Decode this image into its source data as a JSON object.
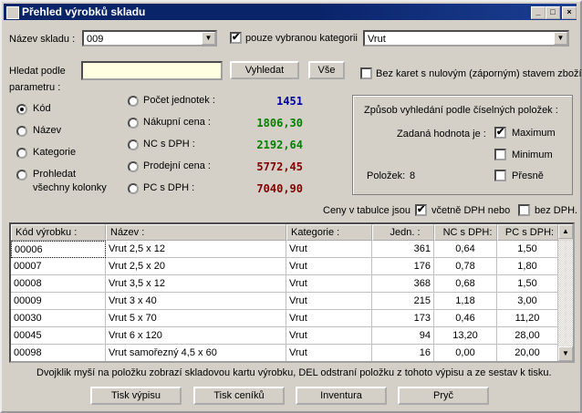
{
  "window": {
    "title": "Přehled výrobků skladu",
    "min": "_",
    "max": "□",
    "close": "×"
  },
  "warehouse": {
    "label": "Název skladu :",
    "value": "009",
    "only_selected_label": "pouze vybranou kategorii",
    "category_value": "Vrut"
  },
  "search": {
    "label_line1": "Hledat podle",
    "label_line2": "parametru :",
    "value": "",
    "search_button": "Vyhledat",
    "all_button": "Vše",
    "zero_stock_label": "Bez karet s nulovým (záporným) stavem zboží"
  },
  "params": [
    {
      "label": "Kód",
      "selected": true
    },
    {
      "label": "Název",
      "selected": false
    },
    {
      "label": "Kategorie",
      "selected": false
    },
    {
      "label": "Prohledat všechny kolonky",
      "line1": "Prohledat",
      "line2": "všechny kolonky",
      "selected": false
    }
  ],
  "stats": [
    {
      "label": "Počet jednotek :",
      "value": "1451",
      "color": "#0000a0"
    },
    {
      "label": "Nákupní cena :",
      "value": "1806,30",
      "color": "#008000"
    },
    {
      "label": "NC s DPH :",
      "value": "2192,64",
      "color": "#008000"
    },
    {
      "label": "Prodejní cena :",
      "value": "5772,45",
      "color": "#800000"
    },
    {
      "label": "PC s DPH :",
      "value": "7040,90",
      "color": "#800000"
    }
  ],
  "numeric_search": {
    "title": "Způsob vyhledání podle číselných položek :",
    "given_value_label": "Zadaná hodnota je :",
    "maximum": "Maximum",
    "minimum": "Minimum",
    "exact": "Přesně",
    "items_label": "Položek:",
    "items_count": "8"
  },
  "prices": {
    "label": "Ceny v tabulce jsou",
    "with_vat": "včetně DPH nebo",
    "without_vat": "bez DPH."
  },
  "table": {
    "columns": [
      "Kód výrobku :",
      "Název :",
      "Kategorie :",
      "Jedn. :",
      "NC s DPH:",
      "PC s DPH:"
    ],
    "rows": [
      [
        "00006",
        "Vrut 2,5 x 12",
        "Vrut",
        "361",
        "0,64",
        "1,50"
      ],
      [
        "00007",
        "Vrut 2,5 x 20",
        "Vrut",
        "176",
        "0,78",
        "1,80"
      ],
      [
        "00008",
        "Vrut 3,5 x 12",
        "Vrut",
        "368",
        "0,68",
        "1,50"
      ],
      [
        "00009",
        "Vrut 3 x 40",
        "Vrut",
        "215",
        "1,18",
        "3,00"
      ],
      [
        "00030",
        "Vrut 5 x 70",
        "Vrut",
        "173",
        "0,46",
        "11,20"
      ],
      [
        "00045",
        "Vrut 6 x 120",
        "Vrut",
        "94",
        "13,20",
        "28,00"
      ],
      [
        "00098",
        "Vrut samořezný 4,5 x 60",
        "Vrut",
        "16",
        "0,00",
        "20,00"
      ]
    ]
  },
  "hint": "Dvojklik myší na položku zobrazí skladovou kartu výrobku, DEL odstraní položku z tohoto výpisu a ze sestav k tisku.",
  "buttons": {
    "print_list": "Tisk výpisu",
    "print_pricelists": "Tisk ceníků",
    "inventory": "Inventura",
    "away": "Pryč"
  }
}
